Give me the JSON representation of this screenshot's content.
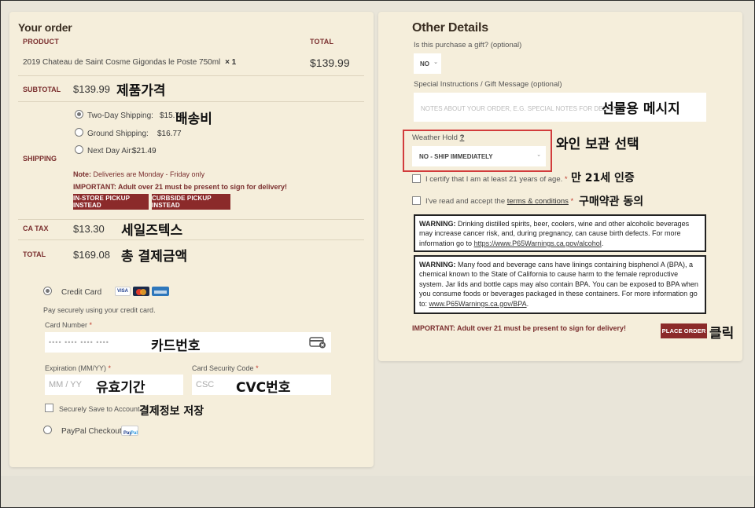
{
  "order": {
    "title": "Your order",
    "col_product": "PRODUCT",
    "col_total": "TOTAL",
    "item_name": "2019 Chateau de Saint Cosme Gigondas le Poste 750ml",
    "item_qty": "× 1",
    "item_price": "$139.99",
    "subtotal_label": "SUBTOTAL",
    "subtotal_value": "$139.99",
    "shipping_label": "SHIPPING",
    "shipping_options": [
      {
        "label": "Two-Day Shipping:",
        "price": "$15.79",
        "selected": true
      },
      {
        "label": "Ground Shipping:",
        "price": "$16.77",
        "selected": false
      },
      {
        "label": "Next Day Air:",
        "price": "$21.49",
        "selected": false
      }
    ],
    "note_label": "Note:",
    "note_text": "Deliveries are Monday - Friday only",
    "important_text": "IMPORTANT: Adult over 21 must be present to sign for delivery!",
    "btn_instore": "IN-STORE PICKUP INSTEAD",
    "btn_curbside": "CURBSIDE PICKUP INSTEAD",
    "tax_label": "CA TAX",
    "tax_value": "$13.30",
    "total_label": "TOTAL",
    "total_value": "$169.08"
  },
  "payment": {
    "credit_label": "Credit Card",
    "credit_desc": "Pay securely using your credit card.",
    "card_number_label": "Card Number",
    "card_number_placeholder": "•••• •••• •••• ••••",
    "required_mark": "*",
    "expiration_label": "Expiration (MM/YY)",
    "expiration_placeholder": "MM / YY",
    "csc_label": "Card Security Code",
    "csc_placeholder": "CSC",
    "save_label": "Securely Save to Account",
    "paypal_label": "PayPal Checkout",
    "card_icons": [
      "visa-icon",
      "mastercard-icon",
      "amex-icon"
    ]
  },
  "other": {
    "title": "Other Details",
    "gift_label": "Is this purchase a gift? (optional)",
    "gift_value": "NO",
    "instructions_label": "Special Instructions / Gift Message (optional)",
    "instructions_placeholder": "NOTES ABOUT YOUR ORDER, E.G. SPECIAL NOTES FOR DELIVERY.",
    "weather_label": "Weather Hold",
    "weather_help": "?",
    "weather_value": "NO - SHIP IMMEDIATELY",
    "certify_text": "I certify that I am at least 21 years of age.",
    "certify_req": "*",
    "terms_prefix": "I've read and accept the",
    "terms_link": "terms & conditions",
    "terms_req": "*",
    "warning1_label": "WARNING:",
    "warning1_text": "Drinking distilled spirits, beer, coolers, wine and other alcoholic beverages may increase cancer risk, and, during pregnancy, can cause birth defects. For more information go to",
    "warning1_link": "https://www.P65Warnings.ca.gov/alcohol",
    "warning2_label": "WARNING:",
    "warning2_text": "Many food and beverage cans have linings containing bisphenol A (BPA), a chemical known to the State of California to cause harm to the female reproductive system. Jar lids and bottle caps may also contain BPA. You can be exposed to BPA when you consume foods or beverages packaged in these containers. For more information go to:",
    "warning2_link": "www.P65Warnings.ca.gov/BPA",
    "important_text": "IMPORTANT: Adult over 21 must be present to sign for delivery!",
    "place_order": "PLACE ORDER"
  },
  "annotations": {
    "product_price": "제품가격",
    "shipping_cost": "배송비",
    "sales_tax": "세일즈텍스",
    "total_amount": "총 결제금액",
    "card_number": "카드번호",
    "expiry": "유효기간",
    "cvc": "CVC번호",
    "save_payment": "결제정보 저장",
    "gift_message": "선물용 메시지",
    "wine_storage": "와인 보관 선택",
    "age_cert": "만 21세 인증",
    "terms_agree": "구매약관 동의",
    "click": "클릭"
  },
  "colors": {
    "accent": "#8b2a2a",
    "panel": "#f5eedb",
    "highlight_box": "#d23c3c"
  }
}
